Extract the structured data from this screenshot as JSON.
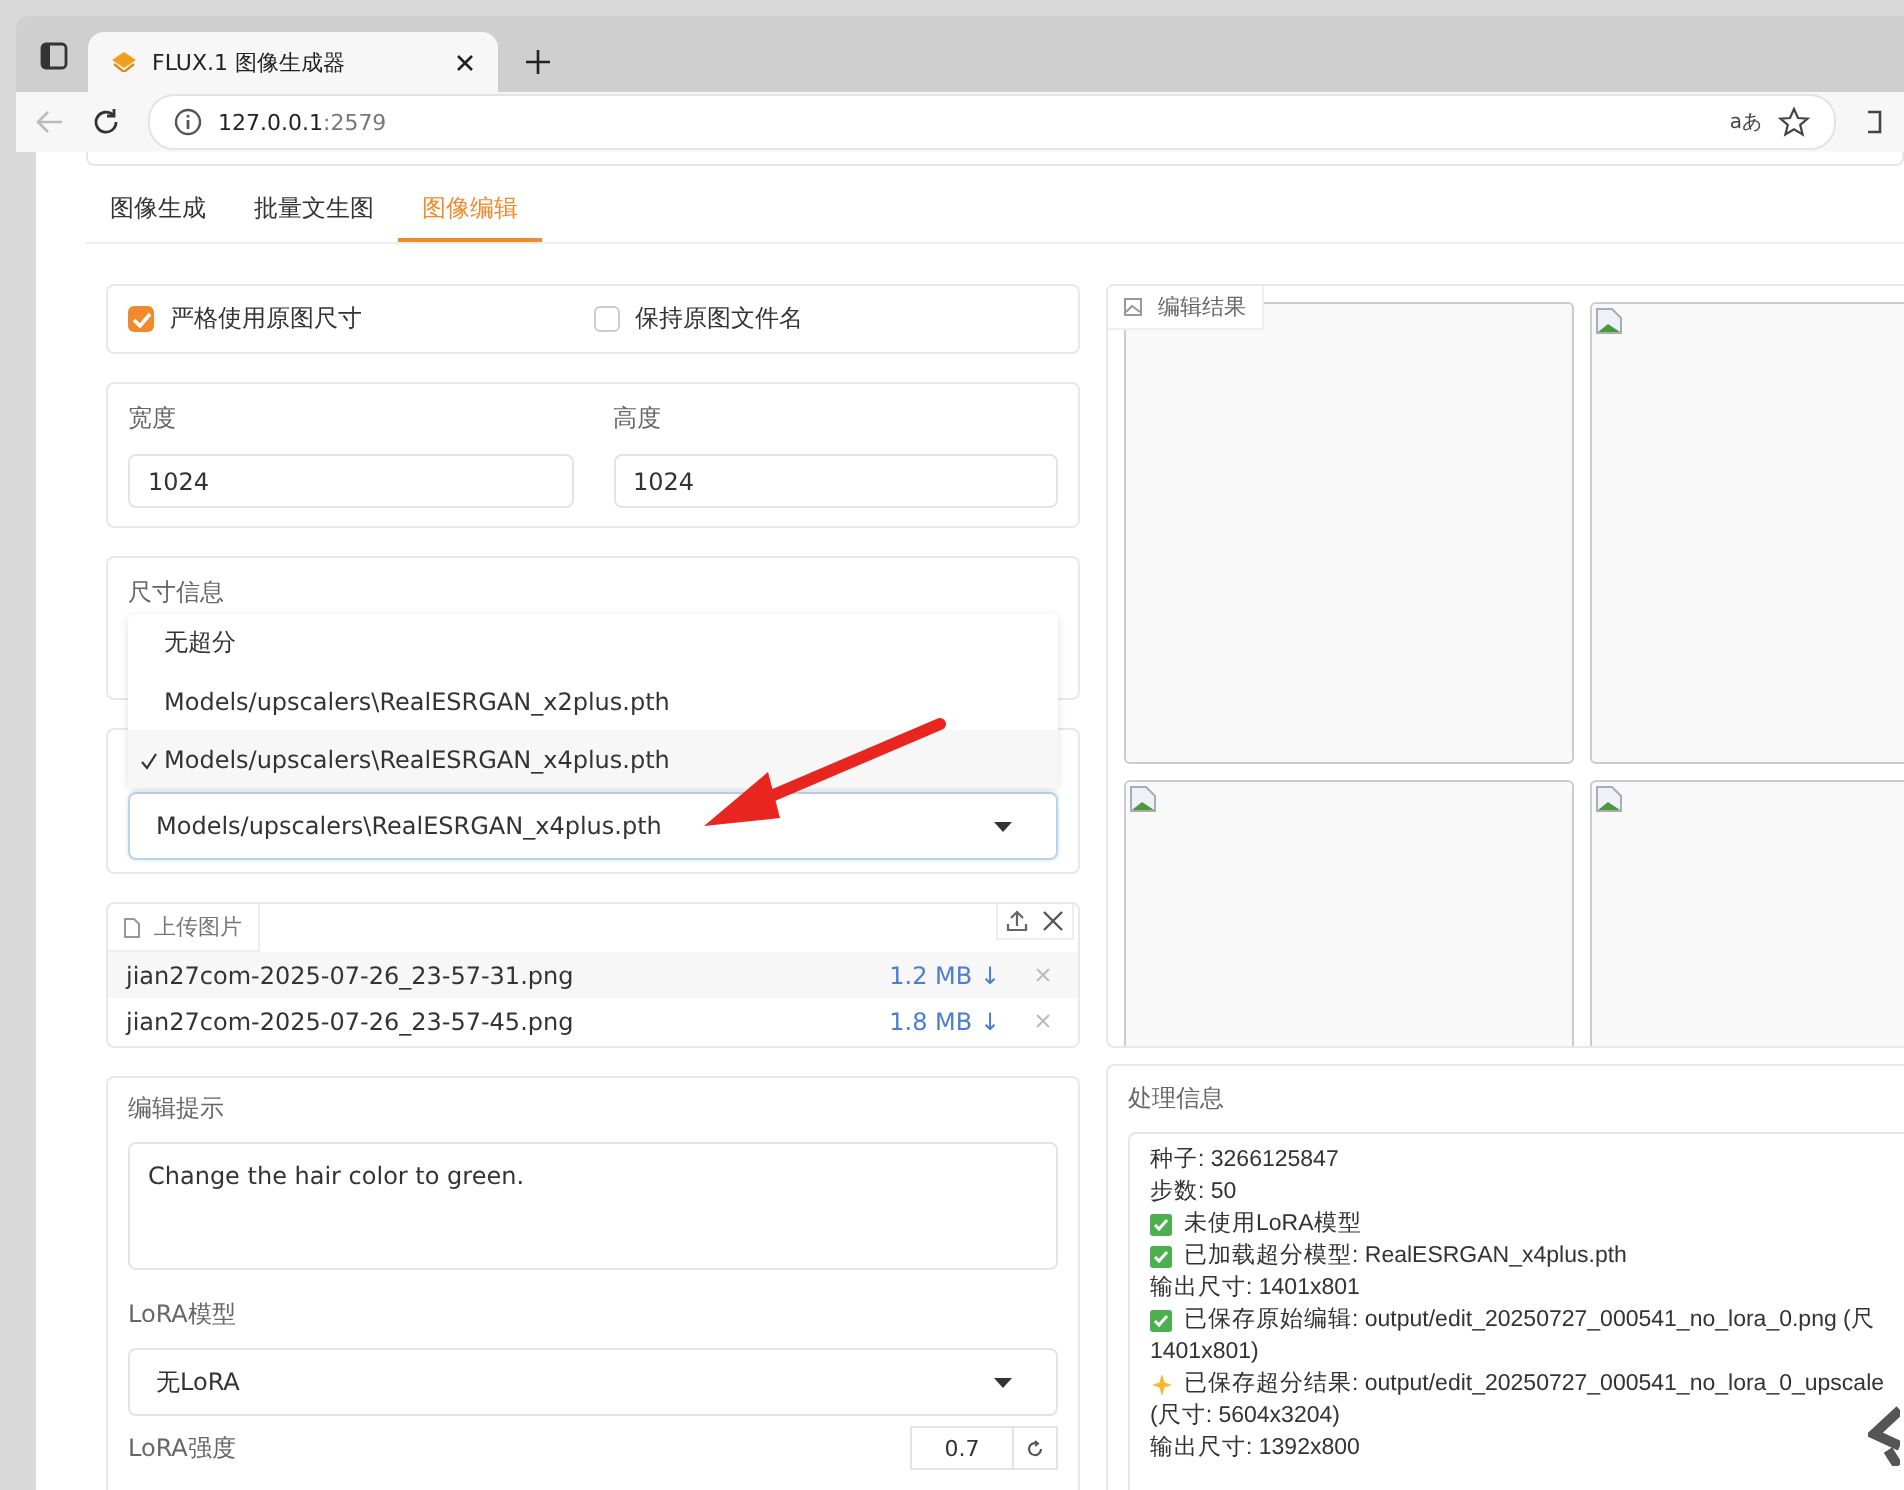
{
  "browser": {
    "tab_title": "FLUX.1 图像生成器",
    "url_host": "127.0.0.1",
    "url_port": ":2579",
    "translate_label": "aあ"
  },
  "tabs": [
    {
      "label": "图像生成",
      "selected": false
    },
    {
      "label": "批量文生图",
      "selected": false
    },
    {
      "label": "图像编辑",
      "selected": true
    }
  ],
  "options": [
    {
      "label": "严格使用原图尺寸",
      "checked": true
    },
    {
      "label": "保持原图文件名",
      "checked": false
    }
  ],
  "width": {
    "label": "宽度",
    "value": "1024"
  },
  "height": {
    "label": "高度",
    "value": "1024"
  },
  "size_info": {
    "label": "尺寸信息"
  },
  "upscale": {
    "value": "Models/upscalers\\RealESRGAN_x4plus.pth",
    "expanded": true,
    "options": [
      {
        "label": "无超分",
        "selected": false
      },
      {
        "label": "Models/upscalers\\RealESRGAN_x2plus.pth",
        "selected": false
      },
      {
        "label": "Models/upscalers\\RealESRGAN_x4plus.pth",
        "selected": true
      }
    ]
  },
  "upload": {
    "label": "上传图片",
    "files": [
      {
        "name": "jian27com-2025-07-26_23-57-31.png",
        "size": "1.2 MB ↓"
      },
      {
        "name": "jian27com-2025-07-26_23-57-45.png",
        "size": "1.8 MB ↓"
      }
    ]
  },
  "prompt": {
    "label": "编辑提示",
    "value": "Change the hair color to green."
  },
  "lora": {
    "label": "LoRA模型",
    "value": "无LoRA"
  },
  "lora_strength": {
    "label": "LoRA强度",
    "value": "0.7"
  },
  "gallery": {
    "label": "编辑结果",
    "images": [
      {
        "kind": "blank"
      },
      {
        "kind": "broken"
      },
      {
        "kind": "broken"
      },
      {
        "kind": "broken"
      }
    ]
  },
  "processing": {
    "label": "处理信息",
    "lines": [
      {
        "kind": "plain",
        "text": "种子: 3266125847"
      },
      {
        "kind": "plain",
        "text": "步数: 50"
      },
      {
        "kind": "check",
        "text": "未使用LoRA模型"
      },
      {
        "kind": "check",
        "text": "已加载超分模型: RealESRGAN_x4plus.pth"
      },
      {
        "kind": "plain",
        "text": "输出尺寸: 1401x801"
      },
      {
        "kind": "check",
        "text": "已保存原始编辑: output/edit_20250727_000541_no_lora_0.png (尺"
      },
      {
        "kind": "plain",
        "text": "1401x801)"
      },
      {
        "kind": "sparkle",
        "text": "已保存超分结果: output/edit_20250727_000541_no_lora_0_upscale"
      },
      {
        "kind": "plain",
        "text": "(尺寸: 5604x3204)"
      },
      {
        "kind": "plain",
        "text": "输出尺寸: 1392x800"
      }
    ]
  }
}
